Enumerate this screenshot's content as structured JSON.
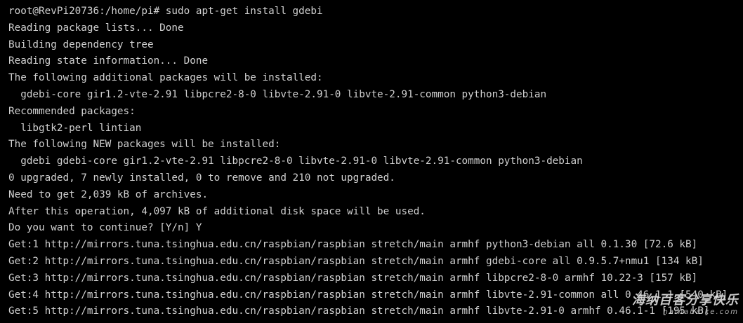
{
  "terminal": {
    "lines": [
      "root@RevPi20736:/home/pi# sudo apt-get install gdebi",
      "Reading package lists... Done",
      "Building dependency tree",
      "Reading state information... Done",
      "The following additional packages will be installed:",
      "  gdebi-core gir1.2-vte-2.91 libpcre2-8-0 libvte-2.91-0 libvte-2.91-common python3-debian",
      "Recommended packages:",
      "  libgtk2-perl lintian",
      "The following NEW packages will be installed:",
      "  gdebi gdebi-core gir1.2-vte-2.91 libpcre2-8-0 libvte-2.91-0 libvte-2.91-common python3-debian",
      "0 upgraded, 7 newly installed, 0 to remove and 210 not upgraded.",
      "Need to get 2,039 kB of archives.",
      "After this operation, 4,097 kB of additional disk space will be used.",
      "Do you want to continue? [Y/n] Y",
      "Get:1 http://mirrors.tuna.tsinghua.edu.cn/raspbian/raspbian stretch/main armhf python3-debian all 0.1.30 [72.6 kB]",
      "Get:2 http://mirrors.tuna.tsinghua.edu.cn/raspbian/raspbian stretch/main armhf gdebi-core all 0.9.5.7+nmu1 [134 kB]",
      "Get:3 http://mirrors.tuna.tsinghua.edu.cn/raspbian/raspbian stretch/main armhf libpcre2-8-0 armhf 10.22-3 [157 kB]",
      "Get:4 http://mirrors.tuna.tsinghua.edu.cn/raspbian/raspbian stretch/main armhf libvte-2.91-common all 0.46.1-1 [540 kB]",
      "Get:5 http://mirrors.tuna.tsinghua.edu.cn/raspbian/raspbian stretch/main armhf libvte-2.91-0 armhf 0.46.1-1 [195 kB]"
    ]
  },
  "watermark": {
    "title": "海纳百客分享快乐",
    "site": "hainabaike.com"
  },
  "colors": {
    "background": "#000000",
    "text": "#d0d0d0"
  }
}
